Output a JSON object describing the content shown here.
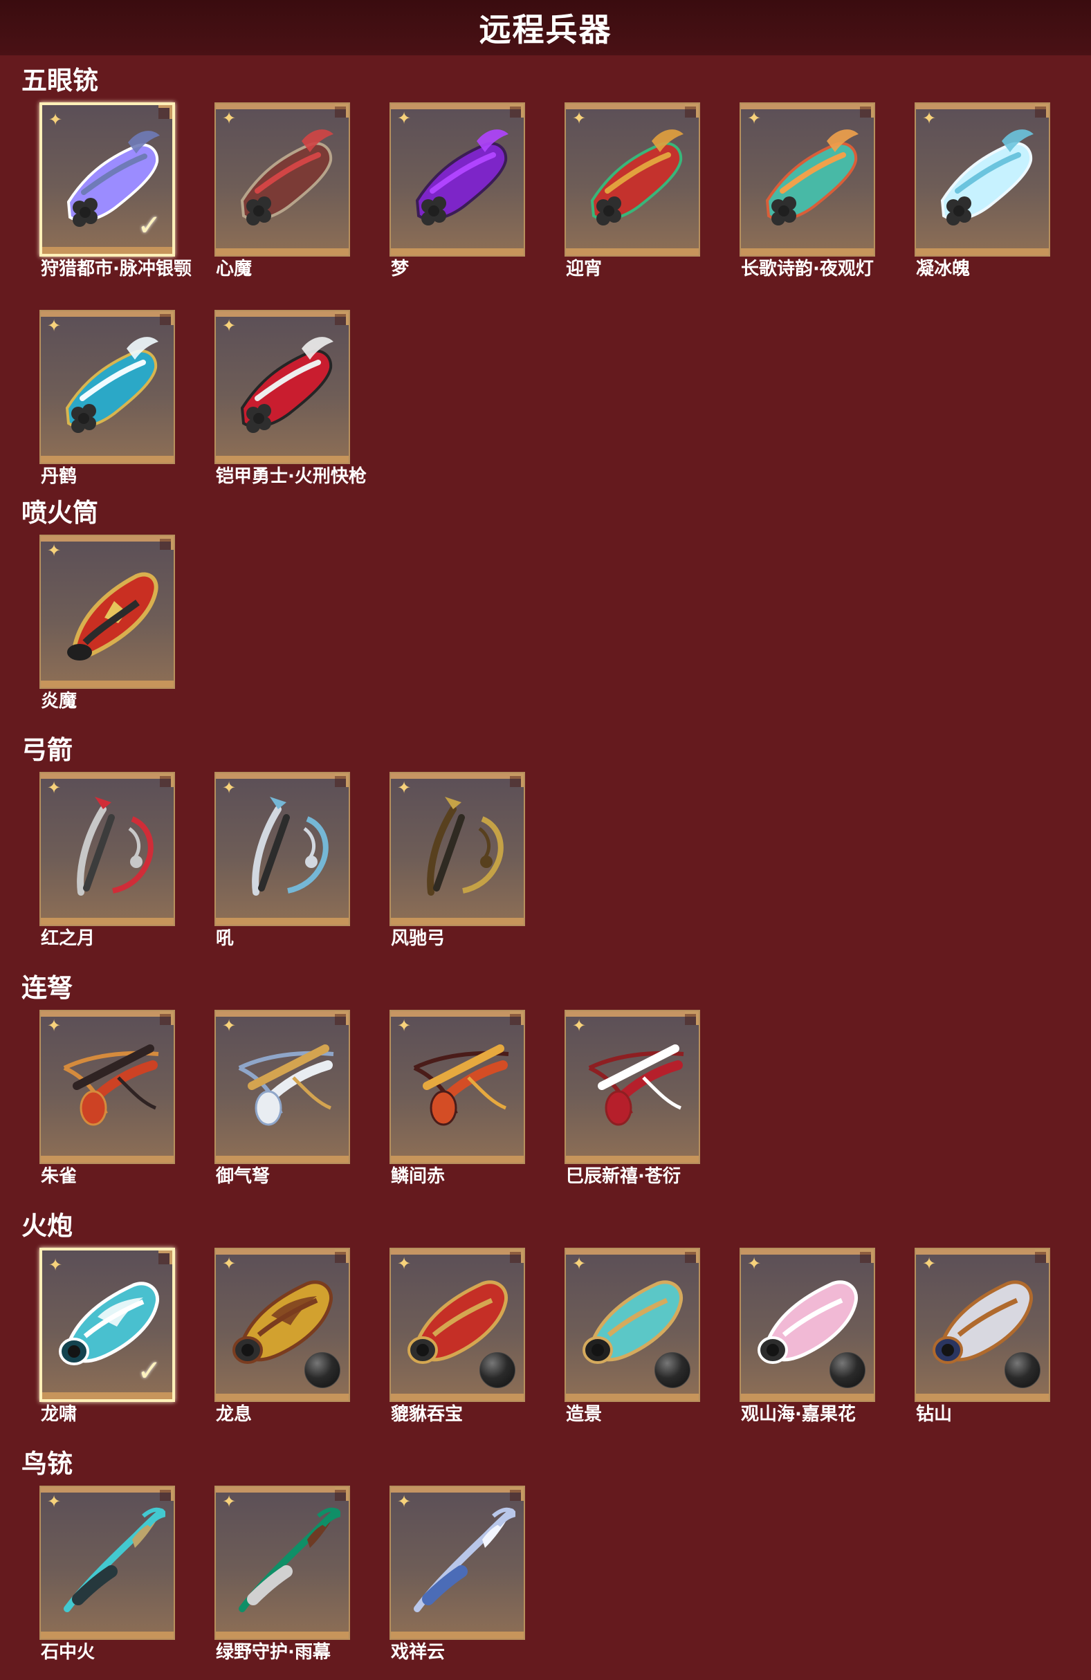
{
  "page_title": "远程兵器",
  "sections": [
    {
      "title": "五眼铳",
      "items": [
        {
          "name": "狩猎都市·脉冲银颚",
          "selected": true,
          "icon": "five-barrel-gun-icon",
          "colors": [
            "#9b8cff",
            "#6f7bb8",
            "#ffffff"
          ]
        },
        {
          "name": "心魔",
          "selected": false,
          "icon": "five-barrel-gun-icon",
          "colors": [
            "#7b3b36",
            "#d24545",
            "#b7a48b"
          ]
        },
        {
          "name": "梦",
          "selected": false,
          "icon": "five-barrel-gun-icon",
          "colors": [
            "#7d25c8",
            "#b044ff",
            "#3b1d55"
          ]
        },
        {
          "name": "迎宵",
          "selected": false,
          "icon": "five-barrel-gun-icon",
          "colors": [
            "#c4322d",
            "#e2a13e",
            "#39b67a"
          ]
        },
        {
          "name": "长歌诗韵·夜观灯",
          "selected": false,
          "icon": "five-barrel-gun-icon",
          "colors": [
            "#48b9a6",
            "#f0a14b",
            "#d95e39"
          ]
        },
        {
          "name": "凝冰魄",
          "selected": false,
          "icon": "five-barrel-gun-icon",
          "colors": [
            "#c7f2ff",
            "#6bc4de",
            "#eef9ff"
          ]
        },
        {
          "name": "丹鹤",
          "selected": false,
          "icon": "five-barrel-gun-icon",
          "colors": [
            "#2ba8c7",
            "#f1fbff",
            "#d8b54f"
          ]
        },
        {
          "name": "铠甲勇士·火刑快枪",
          "selected": false,
          "icon": "five-barrel-gun-icon",
          "colors": [
            "#c91d2f",
            "#eeeeee",
            "#252525"
          ]
        }
      ]
    },
    {
      "title": "喷火筒",
      "items": [
        {
          "name": "炎魔",
          "selected": false,
          "icon": "flamethrower-icon",
          "colors": [
            "#c92f22",
            "#d9b04f",
            "#2b2b2b"
          ]
        }
      ]
    },
    {
      "title": "弓箭",
      "items": [
        {
          "name": "红之月",
          "selected": false,
          "icon": "bow-icon",
          "colors": [
            "#d02d38",
            "#c8c8c8",
            "#3c3c3c"
          ]
        },
        {
          "name": "吼",
          "selected": false,
          "icon": "bow-icon",
          "colors": [
            "#75b7d6",
            "#d2d8e0",
            "#2c2c2c"
          ]
        },
        {
          "name": "风驰弓",
          "selected": false,
          "icon": "bow-icon",
          "colors": [
            "#c5a246",
            "#58401e",
            "#2f2a22"
          ]
        }
      ]
    },
    {
      "title": "连弩",
      "items": [
        {
          "name": "朱雀",
          "selected": false,
          "icon": "crossbow-icon",
          "colors": [
            "#cd4224",
            "#2f2323",
            "#d58b3d"
          ]
        },
        {
          "name": "御气弩",
          "selected": false,
          "icon": "crossbow-icon",
          "colors": [
            "#e9edf2",
            "#d4a450",
            "#8fa6c9"
          ]
        },
        {
          "name": "鳞间赤",
          "selected": false,
          "icon": "crossbow-icon",
          "colors": [
            "#d44d25",
            "#e6a93f",
            "#4a1c19"
          ]
        },
        {
          "name": "巳辰新禧·苍衍",
          "selected": false,
          "icon": "crossbow-icon",
          "colors": [
            "#b61f2b",
            "#ffffff",
            "#8e1f22"
          ]
        }
      ]
    },
    {
      "title": "火炮",
      "items": [
        {
          "name": "龙啸",
          "selected": true,
          "icon": "dragon-cannon-icon",
          "colors": [
            "#49c0cf",
            "#ffffff",
            "#14434f"
          ]
        },
        {
          "name": "龙息",
          "selected": false,
          "icon": "dragon-cannon-icon",
          "colors": [
            "#d2a12f",
            "#7a3c1f",
            "#2d2d2d"
          ]
        },
        {
          "name": "貔貅吞宝",
          "selected": false,
          "icon": "cannon-icon",
          "colors": [
            "#c52f26",
            "#d5a751",
            "#2d2d2d"
          ]
        },
        {
          "name": "造景",
          "selected": false,
          "icon": "cannon-icon",
          "colors": [
            "#5bc7c7",
            "#d5aa5d",
            "#202020"
          ]
        },
        {
          "name": "观山海·嘉果花",
          "selected": false,
          "icon": "cannon-icon",
          "colors": [
            "#f1b9d5",
            "#ffffff",
            "#2d2d2d"
          ]
        },
        {
          "name": "钻山",
          "selected": false,
          "icon": "cannon-icon",
          "colors": [
            "#d8d8e0",
            "#b06a2d",
            "#2a3560"
          ]
        }
      ]
    },
    {
      "title": "鸟铳",
      "items": [
        {
          "name": "石中火",
          "selected": false,
          "icon": "musket-icon",
          "colors": [
            "#43c9d0",
            "#26383d",
            "#bda56b"
          ]
        },
        {
          "name": "绿野守护·雨幕",
          "selected": false,
          "icon": "musket-icon",
          "colors": [
            "#0f8f67",
            "#d1d1d1",
            "#6e3b24"
          ]
        },
        {
          "name": "戏祥云",
          "selected": false,
          "icon": "musket-icon",
          "colors": [
            "#b9c7ea",
            "#4b6cb7",
            "#f3f6ff"
          ]
        }
      ]
    }
  ]
}
